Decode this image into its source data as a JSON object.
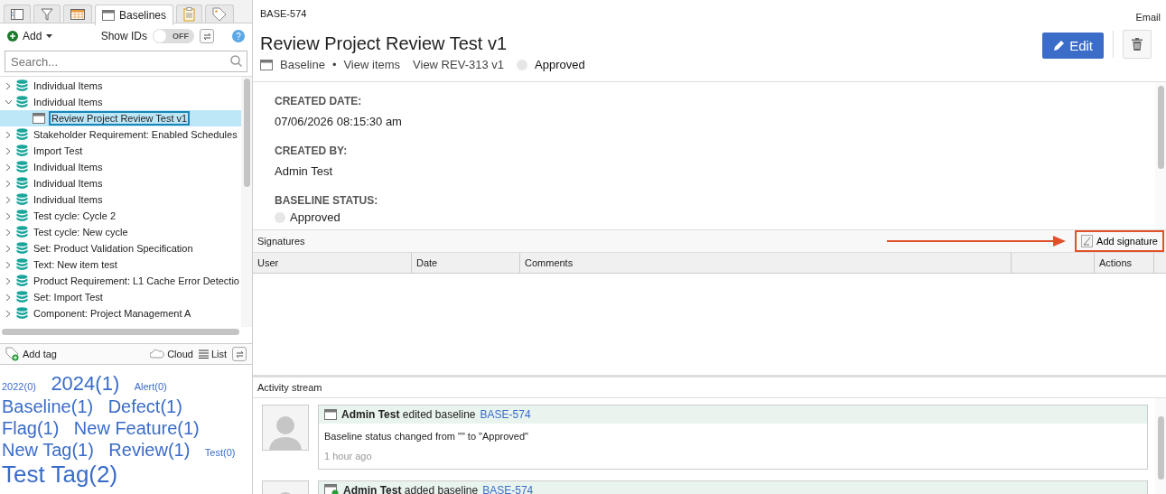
{
  "left_tabs": [
    {
      "kind": "tree",
      "selected": false
    },
    {
      "kind": "filter",
      "selected": false
    },
    {
      "kind": "grid",
      "selected": false
    },
    {
      "kind": "window",
      "label": "Baselines",
      "selected": true
    },
    {
      "kind": "clipboard",
      "selected": false
    },
    {
      "kind": "tag",
      "selected": false
    }
  ],
  "toolbar": {
    "add_label": "Add",
    "show_ids_label": "Show IDs",
    "show_ids": {
      "on": false,
      "label": "OFF"
    },
    "help": "?"
  },
  "search": {
    "placeholder": "Search..."
  },
  "tree": [
    {
      "label": "Individual Items",
      "expanded": false,
      "selected": false
    },
    {
      "label": "Individual Items",
      "expanded": true,
      "selected": false,
      "children": [
        {
          "label": "Review Project Review Test v1",
          "selected": true
        }
      ]
    },
    {
      "label": "Stakeholder Requirement: Enabled Schedules",
      "expanded": false,
      "selected": false
    },
    {
      "label": "Import Test",
      "expanded": false,
      "selected": false
    },
    {
      "label": "Individual Items",
      "expanded": false,
      "selected": false
    },
    {
      "label": "Individual Items",
      "expanded": false,
      "selected": false
    },
    {
      "label": "Individual Items",
      "expanded": false,
      "selected": false
    },
    {
      "label": "Test cycle: Cycle 2",
      "expanded": false,
      "selected": false
    },
    {
      "label": "Test cycle: New cycle",
      "expanded": false,
      "selected": false
    },
    {
      "label": "Set: Product Validation Specification",
      "expanded": false,
      "selected": false
    },
    {
      "label": "Text: New item test",
      "expanded": false,
      "selected": false
    },
    {
      "label": "Product Requirement: L1 Cache Error Detectio",
      "expanded": false,
      "selected": false
    },
    {
      "label": "Set: Import Test",
      "expanded": false,
      "selected": false
    },
    {
      "label": "Component: Project Management A",
      "expanded": false,
      "selected": false
    }
  ],
  "tag_toolbar": {
    "add_tag": "Add tag",
    "cloud": "Cloud",
    "list": "List"
  },
  "tags": [
    {
      "label": "2022(0)",
      "kind": "small"
    },
    {
      "label": "2024(1)",
      "kind": "large"
    },
    {
      "label": "Alert(0)",
      "kind": "small"
    },
    {
      "label": "Baseline(1)",
      "kind": "medium"
    },
    {
      "label": "Defect(1)",
      "kind": "medium"
    },
    {
      "label": "Flag(1)",
      "kind": "medium"
    },
    {
      "label": "New Feature(1)",
      "kind": "medium"
    },
    {
      "label": "New Tag(1)",
      "kind": "medium"
    },
    {
      "label": "Review(1)",
      "kind": "medium"
    },
    {
      "label": "Test(0)",
      "kind": "small"
    },
    {
      "label": "Test Tag(2)",
      "kind": "huge"
    }
  ],
  "header": {
    "id": "BASE-574",
    "email": "Email",
    "title": "Review Project Review Test v1",
    "type": "Baseline",
    "separator": "•",
    "view_items": "View items",
    "view_review": "View REV-313 v1",
    "status": "Approved",
    "edit": "Edit"
  },
  "fields": [
    {
      "label": "CREATED DATE:",
      "value": "07/06/2026 08:15:30 am",
      "kind": "text"
    },
    {
      "label": "CREATED BY:",
      "value": "Admin Test",
      "kind": "text"
    },
    {
      "label": "BASELINE STATUS:",
      "value": "Approved",
      "kind": "radio",
      "selected": false
    }
  ],
  "signatures": {
    "title": "Signatures",
    "add": "Add signature",
    "highlighted": true,
    "columns": [
      "User",
      "Date",
      "Comments",
      "",
      "Actions"
    ]
  },
  "activity": {
    "title": "Activity stream",
    "items": [
      {
        "kind": "edited",
        "user": "Admin Test",
        "action": "edited baseline",
        "link": "BASE-574",
        "detail": "Baseline status changed from \"\" to \"Approved\"",
        "time": "1 hour ago"
      },
      {
        "kind": "added",
        "user": "Admin Test",
        "action": "added baseline",
        "link": "BASE-574"
      }
    ]
  }
}
